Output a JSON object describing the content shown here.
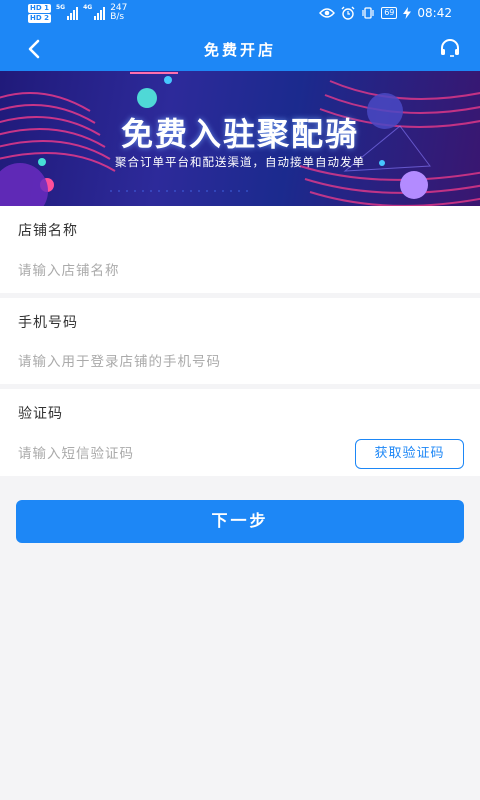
{
  "status_bar": {
    "hd_top": "HD 1",
    "hd_bottom": "HD 2",
    "net_primary": "5G",
    "net_secondary": "4G",
    "speed_value": "247",
    "speed_unit": "B/s",
    "battery": "69",
    "time": "08:42"
  },
  "nav": {
    "title": "免费开店",
    "back_icon": "chevron-left-icon",
    "service_icon": "customer-service-icon"
  },
  "banner": {
    "title": "免费入驻聚配骑",
    "subtitle": "聚合订单平台和配送渠道，自动接单自动发单"
  },
  "form": {
    "shop_name": {
      "label": "店铺名称",
      "placeholder": "请输入店铺名称",
      "value": ""
    },
    "phone": {
      "label": "手机号码",
      "placeholder": "请输入用于登录店铺的手机号码",
      "value": ""
    },
    "code": {
      "label": "验证码",
      "placeholder": "请输入短信验证码",
      "value": "",
      "button_label": "获取验证码"
    }
  },
  "actions": {
    "next_label": "下一步"
  },
  "colors": {
    "primary": "#1d87f6",
    "page_bg": "#f4f4f6",
    "placeholder": "#aaaaaa"
  }
}
